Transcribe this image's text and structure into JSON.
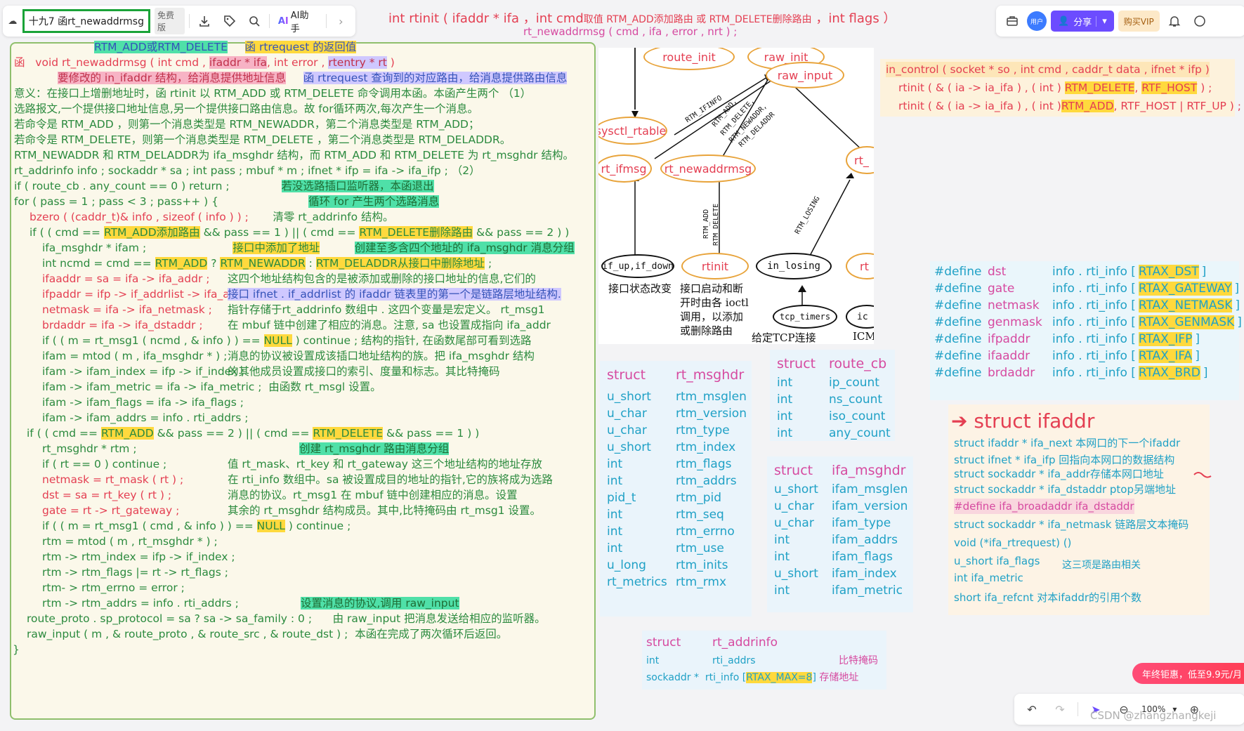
{
  "toolbar": {
    "doc_title": "十九7 函rt_newaddrmsg",
    "free_badge": "免费版",
    "ai_label": "AI助手",
    "avatar_label": "用户",
    "share_label": "分享",
    "vip_label": "购买VIP"
  },
  "bottom_bar": {
    "zoom": "100%"
  },
  "header_note": {
    "line1a": "int   rtinit ( ifaddr * ifa ，int  cmd",
    "line1b": "取值 RTM_ADD添加路由 或 RTM_DELETE删除路由",
    "line1c": " ，int  flags ）",
    "line2": "rt_newaddrmsg ( cmd , ifa , error , nrt ) ;"
  },
  "code": {
    "l00a": "RTM_ADD或RTM_DELETE",
    "l00b": "函 rtrequest 的返回值",
    "l01a": "函",
    "l01b": "void  rt_newaddrmsg ( int  cmd ,",
    "l01c": "ifaddr * ifa",
    "l01d": ", int  error ,",
    "l01e": "rtentry * rt",
    "l01f": ")",
    "l02a": "要修改的 in_ifaddr 结构，给消息提供地址信息",
    "l02b": "函 rtrequest 查询到的对应路由，给消息提供路由信息",
    "l03": "意义：在接口上增删地址时，函 rtinit 以 RTM_ADD 或 RTM_DELETE 命令调用本函。本函产生两个        （1）",
    "l04": "选路报文,一个提供接口地址信息,另一个提供接口路由信息。故 for循环两次,每次产生一个消息。",
    "l05": "若命令是 RTM_ADD        ，则第一个消息类型是 RTM_NEWADDR，第二个消息类型是 RTM_ADD；",
    "l06": "若命令是 RTM_DELETE，则第一个消息类型是 RTM_DELETE         ，第二个消息类型是 RTM_DELADDR。",
    "l07": "RTM_NEWADDR 和 RTM_DELADDR为 ifa_msghdr 结构，而 RTM_ADD 和 RTM_DELETE 为 rt_msghdr 结构。",
    "l08": "rt_addrinfo  info ;       sockaddr * sa ;       int  pass ;      mbuf * m ;       ifnet * ifp = ifa -> ifa_ifp ;     （2）",
    "l09a": "if ( route_cb . any_count == 0 )        return ;",
    "l09b": "若没选路插口监听器，本函退出",
    "l10a": "for ( pass = 1 ; pass < 3 ; pass++ ) {",
    "l10b": "循环 for 产生两个选路消息",
    "l11a": "bzero ( (caddr_t)& info , sizeof ( info ) ) ;",
    "l11b": "清零 rt_addrinfo 结构。",
    "l12a": "if ( ( cmd ==",
    "l12b": "RTM_ADD添加路由",
    "l12c": "&& pass == 1 )  || ( cmd ==",
    "l12d": "RTM_DELETE删除路由",
    "l12e": "&& pass == 2 ) )",
    "l13a": "ifa_msghdr * ifam ;",
    "l13b": "接口中添加了地址",
    "l13c": "创建至多含四个地址的 ifa_msghdr 消息分组",
    "l14a": "int  ncmd = cmd ==",
    "l14b": "RTM_ADD",
    "l14c": "?",
    "l14d": "RTM_NEWADDR",
    "l14e": ":",
    "l14f": "RTM_DELADDR从接口中删除地址",
    "l14g": ";",
    "l15a": "ifaaddr = sa = ifa -> ifa_addr ;",
    "l15b": "这四个地址结构包含的是被添加或删除的接口地址的信息,它们的",
    "l16a": "ifpaddr = ifp -> if_addrlist -> ifa_addr ;",
    "l16b": "接口 ifnet . if_addrlist 的 ifaddr 链表里的第一个是链路层地址结构.",
    "l17a": "netmask = ifa -> ifa_netmask ;",
    "l17b": "指针存储于rt_addrinfo 数组中 . 这四个变量是宏定义。  rt_msg1",
    "l18a": "brdaddr = ifa -> ifa_dstaddr ;",
    "l18b": "在 mbuf 链中创建了相应的消息。注意, sa 也设置成指向 ifa_addr",
    "l19a": "if ( ( m = rt_msg1 ( ncmd , & info ) )  ==",
    "l19b": "NULL",
    "l19c": ")        continue ;      结构的指针, 在函数尾部可看到选路",
    "l20a": "ifam = mtod ( m , ifa_msghdr * ) ;",
    "l20b": "消息的协议被设置成该插口地址结构的族。把 ifa_msghdr 结构",
    "l21a": "ifam -> ifam_index = ifp -> if_index ;",
    "l21b": "的其他成员设置成接口的索引、度量和标志。其比特掩码",
    "l22a": "ifam -> ifam_metric = ifa -> ifa_metric ;",
    "l22b": "由函数 rt_msgl 设置。",
    "l23": "ifam -> ifam_flags = ifa -> ifa_flags ;",
    "l24": "ifam -> ifam_addrs = info . rti_addrs ;",
    "l25a": "if ( ( cmd ==",
    "l25b": "RTM_ADD",
    "l25c": "&& pass == 2 )  || ( cmd ==",
    "l25d": "RTM_DELETE",
    "l25e": "&& pass == 1 ) )",
    "l26a": "rt_msghdr * rtm ;",
    "l26b": "创建 rt_msghdr 路由消息分组",
    "l27a": "if ( rt == 0 )        continue ;",
    "l27b": "值 rt_mask、rt_key 和 rt_gateway 这三个地址结构的地址存放",
    "l28a": "netmask = rt_mask ( rt ) ;",
    "l28b": "在 rti_info 数组中。sa 被设置成目的地址的指针,它的族将成为选路",
    "l29a": "dst = sa = rt_key ( rt ) ;",
    "l29b": "消息的协议。rt_msg1 在 mbuf 链中创建相应的消息。设置",
    "l30a": "gate = rt -> rt_gateway ;",
    "l30b": "其余的 rt_msghdr 结构成员。其中,比特掩码由 rt_msg1 设置。",
    "l31a": "if ( ( m = rt_msg1 ( cmd , & info ) )  ==",
    "l31b": "NULL",
    "l31c": ")        continue ;",
    "l32": "rtm = mtod ( m , rt_msghdr * ) ;",
    "l33": "rtm -> rtm_index = ifp -> if_index ;",
    "l34": "rtm -> rtm_flags  |=  rt -> rt_flags ;",
    "l35": "rtm- > rtm_errno = error ;",
    "l36a": "rtm -> rtm_addrs = info . rti_addrs ;",
    "l36b": "设置消息的协议,调用 raw_input",
    "l37a": "route_proto . sp_protocol = sa ? sa -> sa_family : 0 ;",
    "l37b": "由 raw_input 把消息发送给相应的监听器。",
    "l38a": "raw_input ( m , & route_proto , & route_src , & route_dst ) ;",
    "l38b": "本函在完成了两次循环后返回。",
    "l39": "}"
  },
  "diagram": {
    "route_init": "route_init",
    "raw_init": "raw_init",
    "raw_input": "raw_input",
    "sysctl_rtable": "sysctl_rtable",
    "rt_ifmsg": "rt_ifmsg",
    "rt_newaddrmsg": "rt_newaddrmsg",
    "rt_partial": "rt_",
    "rt_partial2": "rt",
    "if_up": "if_up,if_down",
    "rtinit": "rtinit",
    "in_losing": "in_losing",
    "tcp_timers": "tcp_timers",
    "ic_partial": "ic",
    "cap1": "接口状态改变",
    "cap2a": "接口启动和断",
    "cap2b": "开时由各 ioctl",
    "cap2c": "调用，以添加",
    "cap2d": "或删除路由",
    "cap3": "给定TCP连接",
    "cap4": "ICM",
    "rot_ifinfo": "RTM_IFINFO",
    "rot_add": "RTM_ADD,",
    "rot_delete": "RTM_DELETE,",
    "rot_newaddr": "RTM_NEWADDR,",
    "rot_deladdr": "RTM_DELADDR",
    "rot_vadd": "RTM_ADD",
    "rot_vdelete": "RTM_DELETE",
    "rot_losing": "RTM_LOSING"
  },
  "in_control": {
    "l1": "in_control ( socket * so , int cmd ,  caddr_t  data ,  ifnet * ifp  )",
    "l2a": "rtinit ( & ( ia -> ia_ifa ) , ( int )",
    "l2b": "RTM_DELETE",
    "l2c": ",",
    "l2d": "RTF_HOST",
    "l2e": ") ;",
    "l3a": "rtinit ( & ( ia -> ia_ifa ) , ( int )",
    "l3b": "RTM_ADD",
    "l3c": ", RTF_HOST | RTF_UP ) ;"
  },
  "rt_msghdr": {
    "header": [
      "struct",
      "rt_msghdr"
    ],
    "rows": [
      [
        "u_short",
        "rtm_msglen"
      ],
      [
        "u_char",
        "rtm_version"
      ],
      [
        "u_char",
        "rtm_type"
      ],
      [
        "u_short",
        "rtm_index"
      ],
      [
        "int",
        "rtm_flags"
      ],
      [
        "int",
        "rtm_addrs"
      ],
      [
        "pid_t",
        "rtm_pid"
      ],
      [
        "int",
        "rtm_seq"
      ],
      [
        "int",
        "rtm_errno"
      ],
      [
        "int",
        "rtm_use"
      ],
      [
        "u_long",
        "rtm_inits"
      ],
      [
        "rt_metrics",
        "rtm_rmx"
      ]
    ]
  },
  "route_cb": {
    "header": [
      "struct",
      "route_cb"
    ],
    "rows": [
      [
        "int",
        "ip_count"
      ],
      [
        "int",
        "ns_count"
      ],
      [
        "int",
        "iso_count"
      ],
      [
        "int",
        "any_count"
      ]
    ]
  },
  "ifa_msghdr": {
    "header": [
      "struct",
      "ifa_msghdr"
    ],
    "rows": [
      [
        "u_short",
        "ifam_msglen"
      ],
      [
        "u_char",
        "ifam_version"
      ],
      [
        "u_char",
        "ifam_type"
      ],
      [
        "int",
        "ifam_addrs"
      ],
      [
        "int",
        "ifam_flags"
      ],
      [
        "u_short",
        "ifam_index"
      ],
      [
        "int",
        "ifam_metric"
      ]
    ]
  },
  "rt_addrinfo": {
    "header": [
      "struct",
      "rt_addrinfo"
    ],
    "r1": [
      "int",
      "rti_addrs",
      "比特掩码"
    ],
    "r2a": "sockaddr *",
    "r2b": "rti_info [",
    "r2c": "RTAX_MAX=8",
    "r2d": "]",
    "r2e": "存储地址"
  },
  "defines": [
    [
      "#define",
      "dst",
      "info . rti_info [",
      "RTAX_DST",
      "]"
    ],
    [
      "#define",
      "gate",
      "info . rti_info [",
      "RTAX_GATEWAY",
      "]"
    ],
    [
      "#define",
      "netmask",
      "info . rti_info [",
      "RTAX_NETMASK",
      "]"
    ],
    [
      "#define",
      "genmask",
      "info . rti_info [",
      "RTAX_GENMASK",
      "]"
    ],
    [
      "#define",
      "ifpaddr",
      "info . rti_info [",
      "RTAX_IFP",
      "]"
    ],
    [
      "#define",
      "ifaaddr",
      "info . rti_info [",
      "RTAX_IFA",
      "]"
    ],
    [
      "#define",
      "brdaddr",
      "info . rti_info [",
      "RTAX_BRD",
      "]"
    ]
  ],
  "ifaddr": {
    "title": "struct ifaddr",
    "l1": "struct ifaddr * ifa_next 本网口的下一个ifaddr",
    "l2": "struct ifnet * ifa_ifp 回指向本网口的数据结构",
    "l3": "struct sockaddr * ifa_addr存储本网口地址",
    "l4": "struct sockaddr * ifa_dstaddr ptop另端地址",
    "l5": "#define ifa_broadaddr ifa_dstaddr",
    "l6": "struct sockaddr * ifa_netmask 链路层文本掩码",
    "l7": "void (*ifa_rtrequest) ()",
    "l8": "u_short ifa_flags",
    "l8b": "这三项是路由相关",
    "l9": "int ifa_metric",
    "l10": "short ifa_refcnt 对本ifaddr的引用个数"
  },
  "promo": "年终钜惠，低至9.9元/月",
  "watermark": "CSDN @zhangzhangkeji",
  "colors": {
    "accent": "#6c4cff",
    "note_green": "#2b8a3e",
    "highlight": "#ffd93d",
    "title_border": "#1aa338"
  }
}
